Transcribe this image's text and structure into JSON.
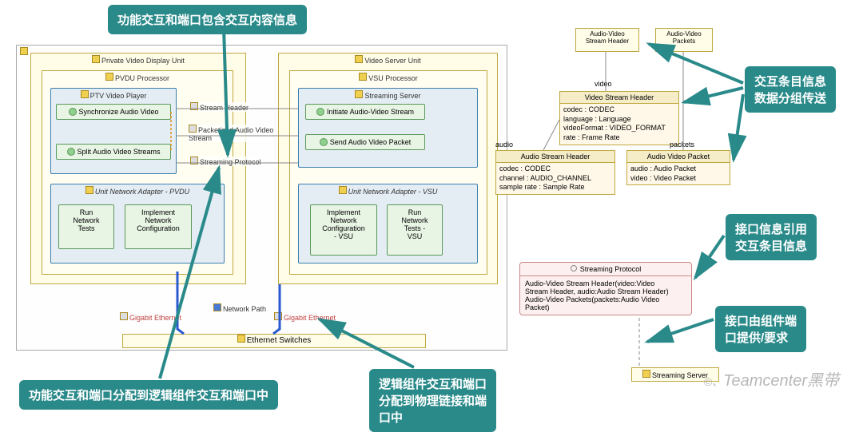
{
  "callouts": {
    "c1": "功能交互和端口包含交互内容信息",
    "c2": "交互条目信息\n数据分组传送",
    "c3": "接口信息引用\n交互条目信息",
    "c4": "接口由组件端\n口提供/要求",
    "c5": "逻辑组件交互和端口\n分配到物理链接和端\n口中",
    "c6": "功能交互和端口分配到逻辑组件交互和端口中"
  },
  "frames": {
    "outer": "",
    "pvdu": "Private Video Display Unit",
    "vsu": "Video Server Unit",
    "pvdu_proc": "PVDU Processor",
    "vsu_proc": "VSU Processor",
    "ptv_player": "PTV Video Player",
    "stream_srv": "Streaming Server",
    "net_pvdu": "Unit Network Adapter - PVDU",
    "net_vsu": "Unit Network Adapter - VSU"
  },
  "funcs": {
    "sync_av": "Synchronize Audio Video",
    "split_av": "Split Audio Video Streams",
    "run_net_tests": "Run\nNetwork\nTests",
    "impl_net_conf": "Implement\nNetwork\nConfiguration",
    "init_av_stream": "Initiate Audio-Video Stream",
    "send_av_pkt": "Send Audio Video Packet",
    "impl_net_conf_vsu": "Implement\nNetwork\nConfiguration\n- VSU",
    "run_net_tests_vsu": "Run\nNetwork\nTests -\nVSU"
  },
  "labels": {
    "stream_header": "Stream Header",
    "pav_stream": "Packetized Audio Video\nStream",
    "stream_proto": "Streaming Protocol",
    "net_path": "Network Path",
    "gig_eth": "Gigabit Ethernet",
    "eth_sw": "Ethernet Switches",
    "video": "video",
    "audio": "audio",
    "packets": "packets"
  },
  "top_blocks": {
    "av_stream_hdr": "Audio-Video\nStream Header",
    "av_packets": "Audio-Video\nPackets"
  },
  "datablocks": {
    "vsh": {
      "title": "Video Stream Header",
      "rows": [
        "codec : CODEC",
        "language : Language",
        "videoFormat : VIDEO_FORMAT",
        "rate : Frame Rate"
      ]
    },
    "ash": {
      "title": "Audio Stream Header",
      "rows": [
        "codec : CODEC",
        "channel : AUDIO_CHANNEL",
        "sample rate : Sample Rate"
      ]
    },
    "avp": {
      "title": "Audio Video Packet",
      "rows": [
        "audio : Audio Packet",
        "video : Video Packet"
      ]
    }
  },
  "protocol": {
    "title": "Streaming Protocol",
    "rows": [
      "Audio-Video Stream Header(video:Video\nStream Header, audio:Audio Stream Header)",
      "Audio-Video Packets(packets:Audio Video\nPacket)"
    ]
  },
  "streaming_server": "Streaming Server",
  "watermark": "Teamcenter黑带"
}
